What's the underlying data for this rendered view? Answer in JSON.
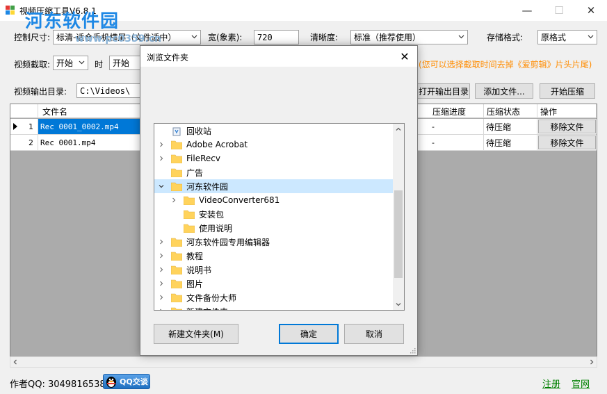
{
  "window": {
    "title": "视频压缩工具V6.8.1",
    "watermark": "河东软件园",
    "watermark_url": "www.pc0359.cn"
  },
  "toolbar": {
    "size_label": "控制尺寸:",
    "size_value": "标清-适合手机横屏（文件适中）",
    "width_label": "宽(象素):",
    "width_value": "720",
    "clarity_label": "清晰度:",
    "clarity_value": "标准（推荐使用）",
    "format_label": "存储格式:",
    "format_value": "原格式",
    "clip_label": "视频截取:",
    "clip_start_value": "开始",
    "clip_time_label": "时",
    "clip_start2_value": "开始",
    "clip_hint": "(您可以选择截取时间去掉《爱剪辑》片头片尾)",
    "output_label": "视频输出目录:",
    "output_value": "C:\\Videos\\",
    "open_output_button": "打开输出目录",
    "add_file_button": "添加文件...",
    "start_button": "开始压缩"
  },
  "grid": {
    "columns": {
      "filename": "文件名",
      "progress": "压缩进度",
      "status": "压缩状态",
      "action": "操作"
    },
    "rows": [
      {
        "index": "1",
        "filename": "Rec 0001_0002.mp4",
        "progress": "-",
        "status": "待压缩",
        "action": "移除文件"
      },
      {
        "index": "2",
        "filename": "Rec 0001.mp4",
        "progress": "-",
        "status": "待压缩",
        "action": "移除文件"
      }
    ]
  },
  "dialog": {
    "title": "浏览文件夹",
    "tree": [
      {
        "label": "回收站",
        "icon": "recycle-bin-icon",
        "expander": ""
      },
      {
        "label": "Adobe Acrobat",
        "icon": "folder-icon",
        "expander": ">"
      },
      {
        "label": "FileRecv",
        "icon": "folder-icon",
        "expander": ">"
      },
      {
        "label": "广告",
        "icon": "folder-icon",
        "expander": ""
      },
      {
        "label": "河东软件园",
        "icon": "folder-icon",
        "expander": "v"
      },
      {
        "label": "VideoConverter681",
        "icon": "folder-icon",
        "expander": ">"
      },
      {
        "label": "安装包",
        "icon": "folder-icon",
        "expander": ""
      },
      {
        "label": "使用说明",
        "icon": "folder-icon",
        "expander": ""
      },
      {
        "label": "河东软件园专用编辑器",
        "icon": "folder-icon",
        "expander": ">"
      },
      {
        "label": "教程",
        "icon": "folder-icon",
        "expander": ">"
      },
      {
        "label": "说明书",
        "icon": "folder-icon",
        "expander": ">"
      },
      {
        "label": "图片",
        "icon": "folder-icon",
        "expander": ">"
      },
      {
        "label": "文件备份大师",
        "icon": "folder-icon",
        "expander": ">"
      },
      {
        "label": "新建文件夹",
        "icon": "folder-icon",
        "expander": ">"
      }
    ],
    "new_folder_button": "新建文件夹(M)",
    "ok_button": "确定",
    "cancel_button": "取消"
  },
  "footer": {
    "author": "作者QQ: 3049816538",
    "qq_button": "QQ交谈",
    "register_link": "注册",
    "website_link": "官网"
  },
  "colors": {
    "selection": "#0078d7",
    "tree_highlight": "#cce8ff",
    "hint": "#ff8c00",
    "link": "#008000",
    "folder": "#ffd35c",
    "watermark": "#1e88e5"
  }
}
